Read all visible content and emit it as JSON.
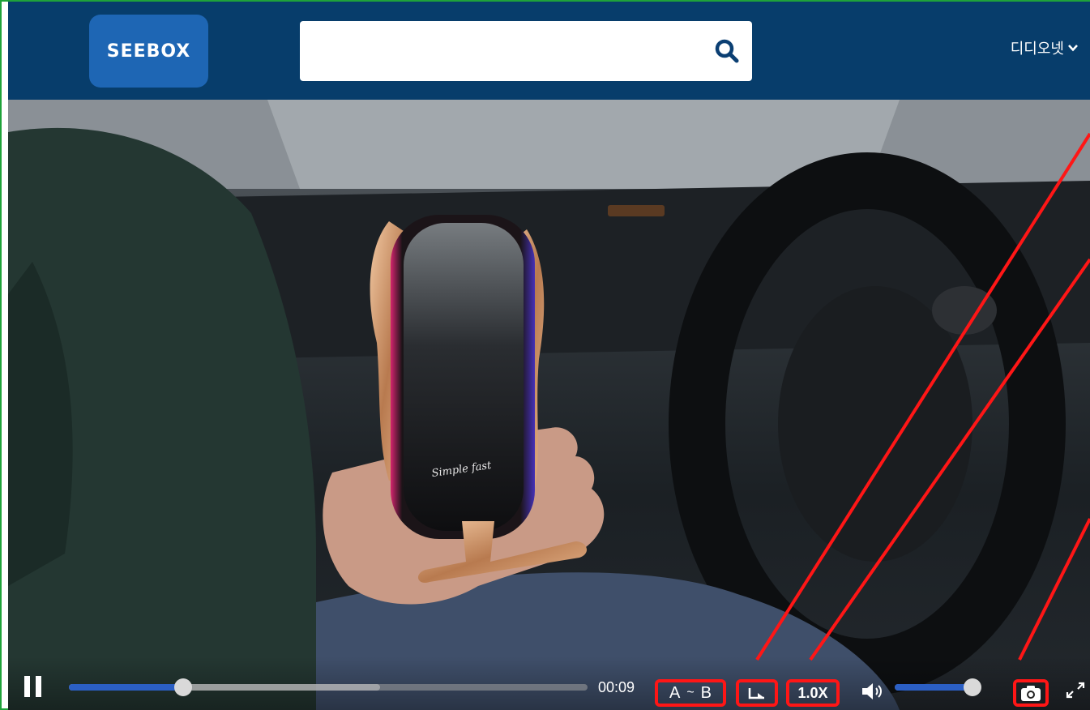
{
  "header": {
    "logo_text": "SEEBOX",
    "search": {
      "value": "",
      "placeholder": ""
    },
    "user_menu_label": "디디오넷"
  },
  "player": {
    "current_time": "00:09",
    "progress_fraction": 0.22,
    "buffered_fraction": 0.6,
    "ab_repeat": {
      "a_label": "A",
      "separator": "~",
      "b_label": "B"
    },
    "speed_label": "1.0X",
    "volume_fraction": 0.92,
    "product_text": "Simple fast"
  },
  "icons": {
    "search": "search-icon",
    "user_menu": "chevron-down-icon",
    "pause": "pause-icon",
    "repeat": "repeat-icon",
    "volume": "volume-icon",
    "capture": "camera-icon",
    "fullscreen": "fullscreen-icon"
  },
  "colors": {
    "header_bg": "#073d6b",
    "logo_bg": "#1e66b4",
    "progress_fill": "#2b5fc4",
    "annotation": "#ff1616",
    "frame_border": "#1fa23a"
  }
}
